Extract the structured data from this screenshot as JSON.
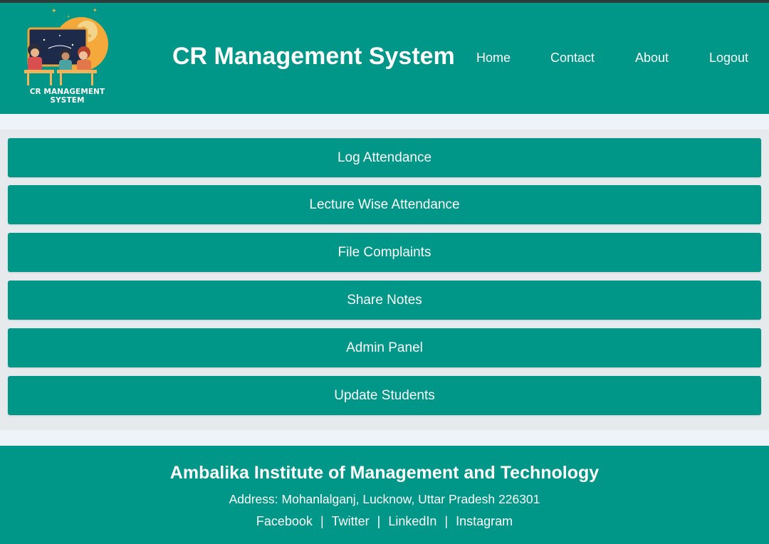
{
  "header": {
    "logo_text": "CR MANAGEMENT SYSTEM",
    "title": "CR Management System",
    "nav": [
      "Home",
      "Contact",
      "About",
      "Logout"
    ]
  },
  "menu": [
    "Log Attendance",
    "Lecture Wise Attendance",
    "File Complaints",
    "Share Notes",
    "Admin Panel",
    "Update Students"
  ],
  "footer": {
    "institute": "Ambalika Institute of Management and Technology",
    "address": "Address: Mohanlalganj, Lucknow, Uttar Pradesh 226301",
    "social": [
      "Facebook",
      "Twitter",
      "LinkedIn",
      "Instagram"
    ],
    "separator": "|"
  },
  "colors": {
    "primary": "#009688",
    "background": "#e7eaed",
    "strip": "#edf3f8",
    "text": "#ffffff"
  },
  "icons": {
    "logo": "classroom-students-illustration"
  }
}
